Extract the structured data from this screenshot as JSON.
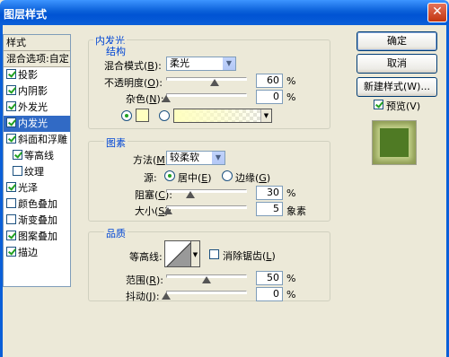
{
  "window": {
    "title": "图层样式",
    "close_symbol": "✕"
  },
  "style_list": {
    "items": [
      {
        "label": "样式",
        "checkbox": false,
        "checked": false,
        "kind": "header"
      },
      {
        "label": "混合选项:自定",
        "checkbox": false,
        "checked": false,
        "kind": "sub"
      },
      {
        "label": "投影",
        "checkbox": true,
        "checked": true,
        "kind": "normal"
      },
      {
        "label": "内阴影",
        "checkbox": true,
        "checked": true,
        "kind": "normal"
      },
      {
        "label": "外发光",
        "checkbox": true,
        "checked": true,
        "kind": "normal"
      },
      {
        "label": "内发光",
        "checkbox": true,
        "checked": true,
        "kind": "selected"
      },
      {
        "label": "斜面和浮雕",
        "checkbox": true,
        "checked": true,
        "kind": "normal"
      },
      {
        "label": "等高线",
        "checkbox": true,
        "checked": true,
        "kind": "indent"
      },
      {
        "label": "纹理",
        "checkbox": true,
        "checked": false,
        "kind": "indent"
      },
      {
        "label": "光泽",
        "checkbox": true,
        "checked": true,
        "kind": "normal"
      },
      {
        "label": "颜色叠加",
        "checkbox": true,
        "checked": false,
        "kind": "normal"
      },
      {
        "label": "渐变叠加",
        "checkbox": true,
        "checked": false,
        "kind": "normal"
      },
      {
        "label": "图案叠加",
        "checkbox": true,
        "checked": true,
        "kind": "normal"
      },
      {
        "label": "描边",
        "checkbox": true,
        "checked": true,
        "kind": "normal"
      }
    ]
  },
  "inner_glow": {
    "title": "内发光",
    "structure": {
      "title": "结构",
      "blend_mode_label": "混合模式(",
      "blend_mode_key": "B",
      "blend_mode_value": "柔光",
      "opacity_label": "不透明度(",
      "opacity_key": "O",
      "opacity_value": "60",
      "opacity_level": 0.6,
      "noise_label": "杂色(",
      "noise_key": "N",
      "noise_value": "0",
      "noise_level": 0.0,
      "percent": "%",
      "color_swatch": "#ffffc0"
    },
    "elements": {
      "title": "图素",
      "method_label": "方法(",
      "method_key": "M",
      "method_value": "较柔软",
      "source_label": "源:",
      "source_center": "居中(",
      "source_center_key": "E",
      "source_edge": "边缘(",
      "source_edge_key": "G",
      "choke_label": "阻塞(",
      "choke_key": "C",
      "choke_value": "30",
      "choke_level": 0.3,
      "size_label": "大小(",
      "size_key": "S",
      "size_value": "5",
      "size_level": 0.02,
      "size_unit": "象素"
    },
    "quality": {
      "title": "品质",
      "contour_label": "等高线:",
      "antialias_label": "消除锯齿(",
      "antialias_key": "L",
      "range_label": "范围(",
      "range_key": "R",
      "range_value": "50",
      "range_level": 0.5,
      "jitter_label": "抖动(",
      "jitter_key": "J",
      "jitter_value": "0",
      "jitter_level": 0.0
    }
  },
  "buttons": {
    "ok": "确定",
    "cancel": "取消",
    "new_style": "新建样式(W)...",
    "preview_label": "预览(V)"
  },
  "colors": {
    "accent": "#316ac5",
    "glow": "#ffffc0",
    "preview_fill": "#4f7a24"
  }
}
